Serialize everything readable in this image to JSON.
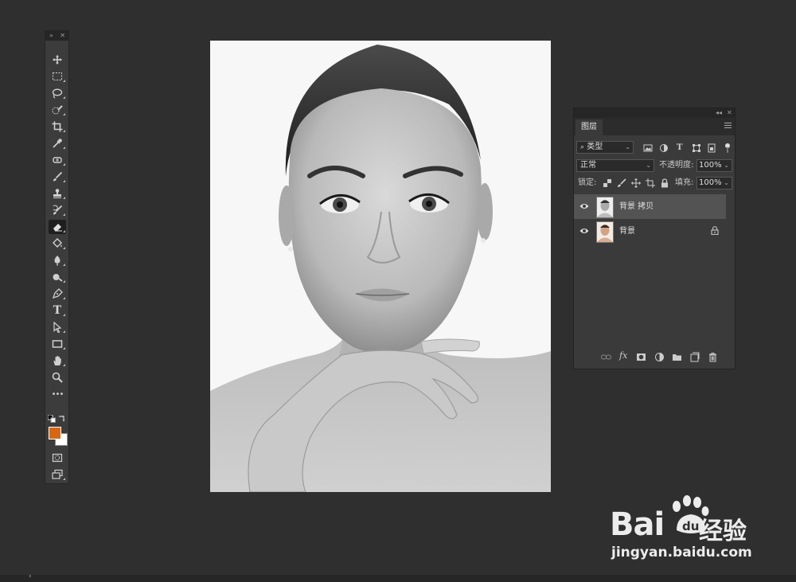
{
  "toolbar": {
    "collapse_glyph": "»",
    "close_glyph": "✕",
    "tools": [
      {
        "name": "move-tool-icon"
      },
      {
        "name": "marquee-tool-icon"
      },
      {
        "name": "lasso-tool-icon"
      },
      {
        "name": "quick-select-tool-icon"
      },
      {
        "name": "crop-tool-icon"
      },
      {
        "name": "eyedropper-tool-icon"
      },
      {
        "name": "healing-brush-tool-icon"
      },
      {
        "name": "brush-tool-icon"
      },
      {
        "name": "clone-stamp-tool-icon"
      },
      {
        "name": "history-brush-tool-icon"
      },
      {
        "name": "eraser-tool-icon",
        "active": true
      },
      {
        "name": "paint-bucket-tool-icon"
      },
      {
        "name": "blur-tool-icon"
      },
      {
        "name": "dodge-tool-icon"
      },
      {
        "name": "pen-tool-icon"
      },
      {
        "name": "type-tool-icon",
        "glyph": "T"
      },
      {
        "name": "path-select-tool-icon"
      },
      {
        "name": "rectangle-tool-icon"
      },
      {
        "name": "hand-tool-icon"
      },
      {
        "name": "zoom-tool-icon"
      },
      {
        "name": "more-tools-icon",
        "glyph": "•••"
      }
    ],
    "foreground_color": "#d86713",
    "background_color": "#ffffff"
  },
  "layers_panel": {
    "top_glyphs": {
      "collapse": "◂◂",
      "close": "✕"
    },
    "tab_label": "图层",
    "filter_kind": "类型",
    "blend_mode": "正常",
    "opacity_label": "不透明度:",
    "opacity_value": "100%",
    "lock_label": "锁定:",
    "fill_label": "填充:",
    "fill_value": "100%",
    "layers": [
      {
        "name": "背景 拷贝",
        "selected": true,
        "visible": true,
        "locked": false
      },
      {
        "name": "背景",
        "selected": false,
        "visible": true,
        "locked": true
      }
    ]
  },
  "watermark": {
    "brand": "Bai",
    "brand_tail": "du",
    "product": "经验",
    "url": "jingyan.baidu.com"
  },
  "status": {
    "arrow": "›"
  }
}
